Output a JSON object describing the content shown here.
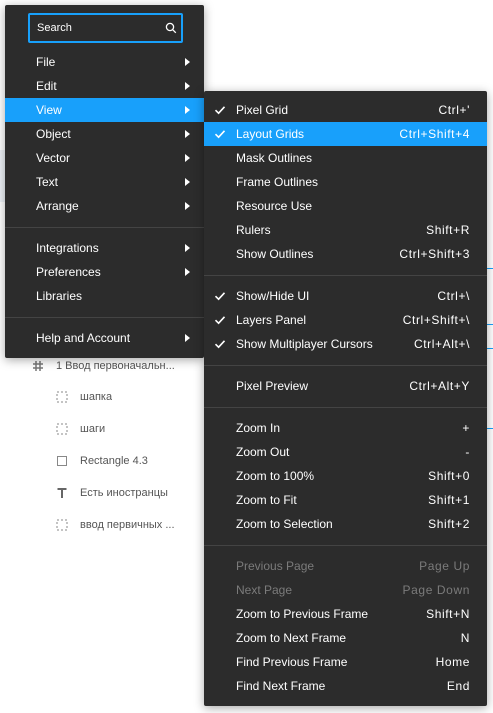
{
  "search": {
    "placeholder": "Search"
  },
  "main_menu": {
    "items": [
      {
        "label": "File",
        "has_submenu": true
      },
      {
        "label": "Edit",
        "has_submenu": true
      },
      {
        "label": "View",
        "has_submenu": true,
        "active": true
      },
      {
        "label": "Object",
        "has_submenu": true
      },
      {
        "label": "Vector",
        "has_submenu": true
      },
      {
        "label": "Text",
        "has_submenu": true
      },
      {
        "label": "Arrange",
        "has_submenu": true
      },
      {
        "label": "Integrations",
        "has_submenu": true
      },
      {
        "label": "Preferences",
        "has_submenu": true
      },
      {
        "label": "Libraries",
        "has_submenu": false
      },
      {
        "label": "Help and Account",
        "has_submenu": true
      }
    ]
  },
  "view_menu": {
    "items": [
      {
        "label": "Pixel Grid",
        "shortcut": "Ctrl+'",
        "checked": true
      },
      {
        "label": "Layout Grids",
        "shortcut": "Ctrl+Shift+4",
        "checked": true,
        "active": true
      },
      {
        "label": "Mask Outlines",
        "shortcut": ""
      },
      {
        "label": "Frame Outlines",
        "shortcut": ""
      },
      {
        "label": "Resource Use",
        "shortcut": ""
      },
      {
        "label": "Rulers",
        "shortcut": "Shift+R"
      },
      {
        "label": "Show Outlines",
        "shortcut": "Ctrl+Shift+3"
      },
      {
        "label": "Show/Hide UI",
        "shortcut": "Ctrl+\\",
        "checked": true
      },
      {
        "label": "Layers Panel",
        "shortcut": "Ctrl+Shift+\\",
        "checked": true
      },
      {
        "label": "Show Multiplayer Cursors",
        "shortcut": "Ctrl+Alt+\\",
        "checked": true
      },
      {
        "label": "Pixel Preview",
        "shortcut": "Ctrl+Alt+Y"
      },
      {
        "label": "Zoom In",
        "shortcut": "+"
      },
      {
        "label": "Zoom Out",
        "shortcut": "-"
      },
      {
        "label": "Zoom to 100%",
        "shortcut": "Shift+0"
      },
      {
        "label": "Zoom to Fit",
        "shortcut": "Shift+1"
      },
      {
        "label": "Zoom to Selection",
        "shortcut": "Shift+2"
      },
      {
        "label": "Previous Page",
        "shortcut": "Page Up",
        "disabled": true
      },
      {
        "label": "Next Page",
        "shortcut": "Page Down",
        "disabled": true
      },
      {
        "label": "Zoom to Previous Frame",
        "shortcut": "Shift+N"
      },
      {
        "label": "Zoom to Next Frame",
        "shortcut": "N"
      },
      {
        "label": "Find Previous Frame",
        "shortcut": "Home"
      },
      {
        "label": "Find Next Frame",
        "shortcut": "End"
      }
    ]
  },
  "layers": [
    {
      "label": "1 Ввод первоначальн...",
      "icon": "frame-hash-icon"
    },
    {
      "label": "шапка",
      "icon": "dashed-frame-icon"
    },
    {
      "label": "шаги",
      "icon": "dashed-frame-icon"
    },
    {
      "label": "Rectangle 4.3",
      "icon": "rectangle-icon"
    },
    {
      "label": "Есть иностранцы",
      "icon": "text-icon"
    },
    {
      "label": "ввод первичных ...",
      "icon": "dashed-frame-icon"
    }
  ],
  "colors": {
    "menu_bg": "#2c2c2c",
    "accent": "#18a0fb",
    "disabled_text": "#7b7b7b",
    "separator": "#444444"
  }
}
